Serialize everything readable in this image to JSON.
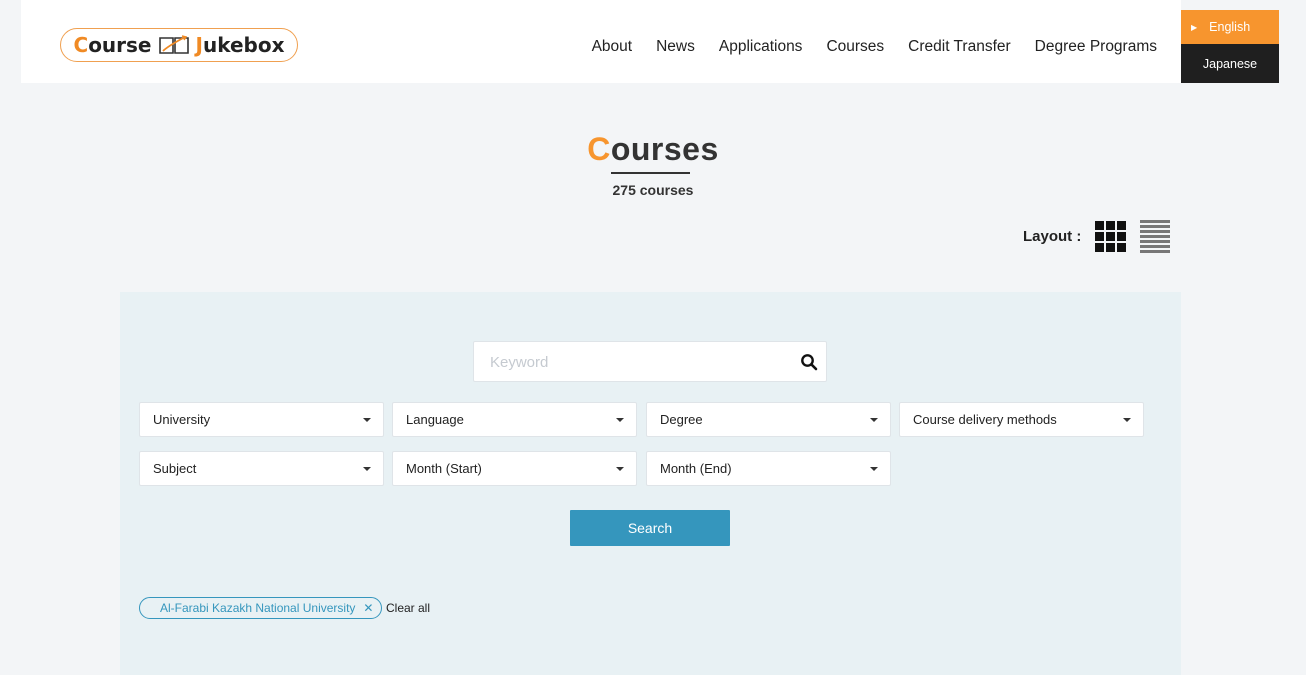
{
  "header": {
    "logo": {
      "first_letter": "C",
      "part1": "ourse",
      "second_letter": "J",
      "part2": "ukebox"
    },
    "nav": [
      "About",
      "News",
      "Applications",
      "Courses",
      "Credit Transfer",
      "Degree Programs"
    ],
    "languages": {
      "english": "English",
      "japanese": "Japanese"
    }
  },
  "page": {
    "title_first": "C",
    "title_rest": "ourses",
    "count": "275 courses"
  },
  "layout": {
    "label": "Layout :"
  },
  "search": {
    "keyword_placeholder": "Keyword",
    "filters_row1": [
      "University",
      "Language",
      "Degree",
      "Course delivery methods"
    ],
    "filters_row2": [
      "Subject",
      "Month (Start)",
      "Month (End)"
    ],
    "button": "Search"
  },
  "active_filters": {
    "chip": "Al-Farabi Kazakh National University",
    "clear": "Clear all"
  },
  "colors": {
    "accent": "#f7952e",
    "primary": "#3596bd",
    "dark": "#1f1f1f"
  },
  "icons": [
    "book-logo-icon",
    "caret-right-icon",
    "grid-layout-icon",
    "list-layout-icon",
    "search-icon",
    "chevron-down-icon",
    "close-icon"
  ]
}
